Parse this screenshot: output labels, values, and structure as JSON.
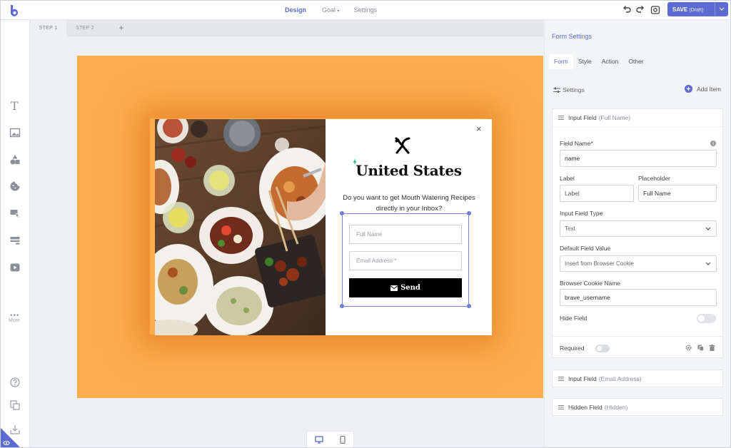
{
  "topbar": {
    "nav": {
      "design": "Design",
      "goal": "Goal",
      "settings": "Settings"
    },
    "save_label": "SAVE",
    "save_status": "(Draft)"
  },
  "left_toolbar": {
    "more_label": "More"
  },
  "steps": {
    "step1": "STEP 1",
    "step2": "STEP 2",
    "add": "+"
  },
  "popup": {
    "close": "×",
    "headline": "United States",
    "subtext": "Do you want to get Mouth Watering Recipes directly in your Inbox?",
    "fullname_placeholder": "Full Name",
    "email_placeholder": "Email Address *",
    "send_label": "Send"
  },
  "panel": {
    "title": "Form Settings",
    "tabs": [
      "Form",
      "Style",
      "Action",
      "Other"
    ],
    "active_tab": "Form",
    "settings_label": "Settings",
    "add_item_label": "Add Item",
    "field_card": {
      "title": "Input Field",
      "subtitle": "(Full Name)",
      "field_name_label": "Field Name*",
      "field_name_value": "name",
      "label_label": "Label",
      "label_value": "Label",
      "placeholder_label": "Placeholder",
      "placeholder_value": "Full Name",
      "type_label": "Input Field Type",
      "type_value": "Text",
      "default_label": "Default Field Value",
      "default_value": "Insert from Browser Cookie",
      "cookie_label": "Browser Cookie Name",
      "cookie_value": "brave_username",
      "hide_label": "Hide Field",
      "hide_on": false,
      "required_label": "Required",
      "required_on": false
    },
    "collapsed_cards": [
      {
        "title": "Input Field",
        "subtitle": "(Email Address)"
      },
      {
        "title": "Hidden Field",
        "subtitle": "(Hidden)"
      }
    ]
  },
  "colors": {
    "accent": "#5c6bd1",
    "canvas_bg": "#fcae4d",
    "button": "#000000"
  }
}
